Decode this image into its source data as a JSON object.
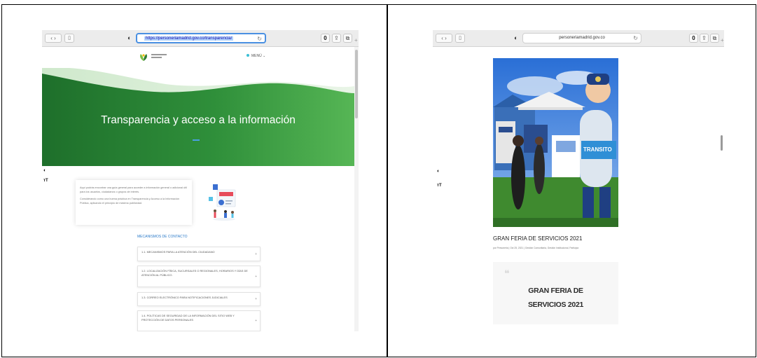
{
  "left": {
    "url": "https://personeriamadrid.gov.co/transparencia/",
    "menu_label": "MENÚ ⌄",
    "hero_title": "Transparencia y acceso a la información",
    "info_paragraphs": [
      "Aquí podrás encontrar una guía general para acceder a información general o adicional útil para los usuarios, ciudadanos o grupos de interés.",
      "Considerando como una buena práctica en Transparencia y Acceso a la Información Pública, aplicando el principio de máxima publicidad."
    ],
    "section_title": "MECANISMOS DE CONTACTO",
    "accordion": [
      "1.1. MECANISMOS PARA LA ATENCIÓN DEL CIUDADANO",
      "1.2. LOCALIZACIÓN FÍSICA, SUCURSALES O REGIONALES, HORARIOS Y DÍAS DE ATENCIÓN AL PÚBLICO.",
      "1.3. CORREO ELECTRÓNICO PARA NOTIFICACIONES JUDICIALES",
      "1.4. POLÍTICAS DE SEGURIDAD DE LA INFORMACIÓN DEL SITIO WEB Y PROTECCIÓN DE DATOS PERSONALES"
    ],
    "plus": "+"
  },
  "right": {
    "url": "personeriamadrid.gov.co",
    "post_title": "GRAN FERIA DE SERVICIOS 2021",
    "post_meta": "por Personeria | Oct 25, 2021 | Gestión Comunitaria, Gestión Institucional, Participa",
    "banner_line1": "GRAN FERIA DE",
    "banner_line2": "SERVICIOS 2021",
    "photo_sign": "TRANSITO"
  },
  "toolbar": {
    "back_forward": "‹ ›",
    "sidebar": "▯",
    "shield": "◐",
    "reload": "↻",
    "badge": "0",
    "share": "⇪",
    "tabs": "⧉",
    "newtab": "+"
  },
  "widgets": {
    "contrast": "◐",
    "text_size": "ᴛT"
  },
  "colors": {
    "hero_dark": "#1d6b2a",
    "hero_light": "#4caf50",
    "accent_blue": "#2c7bc9"
  }
}
